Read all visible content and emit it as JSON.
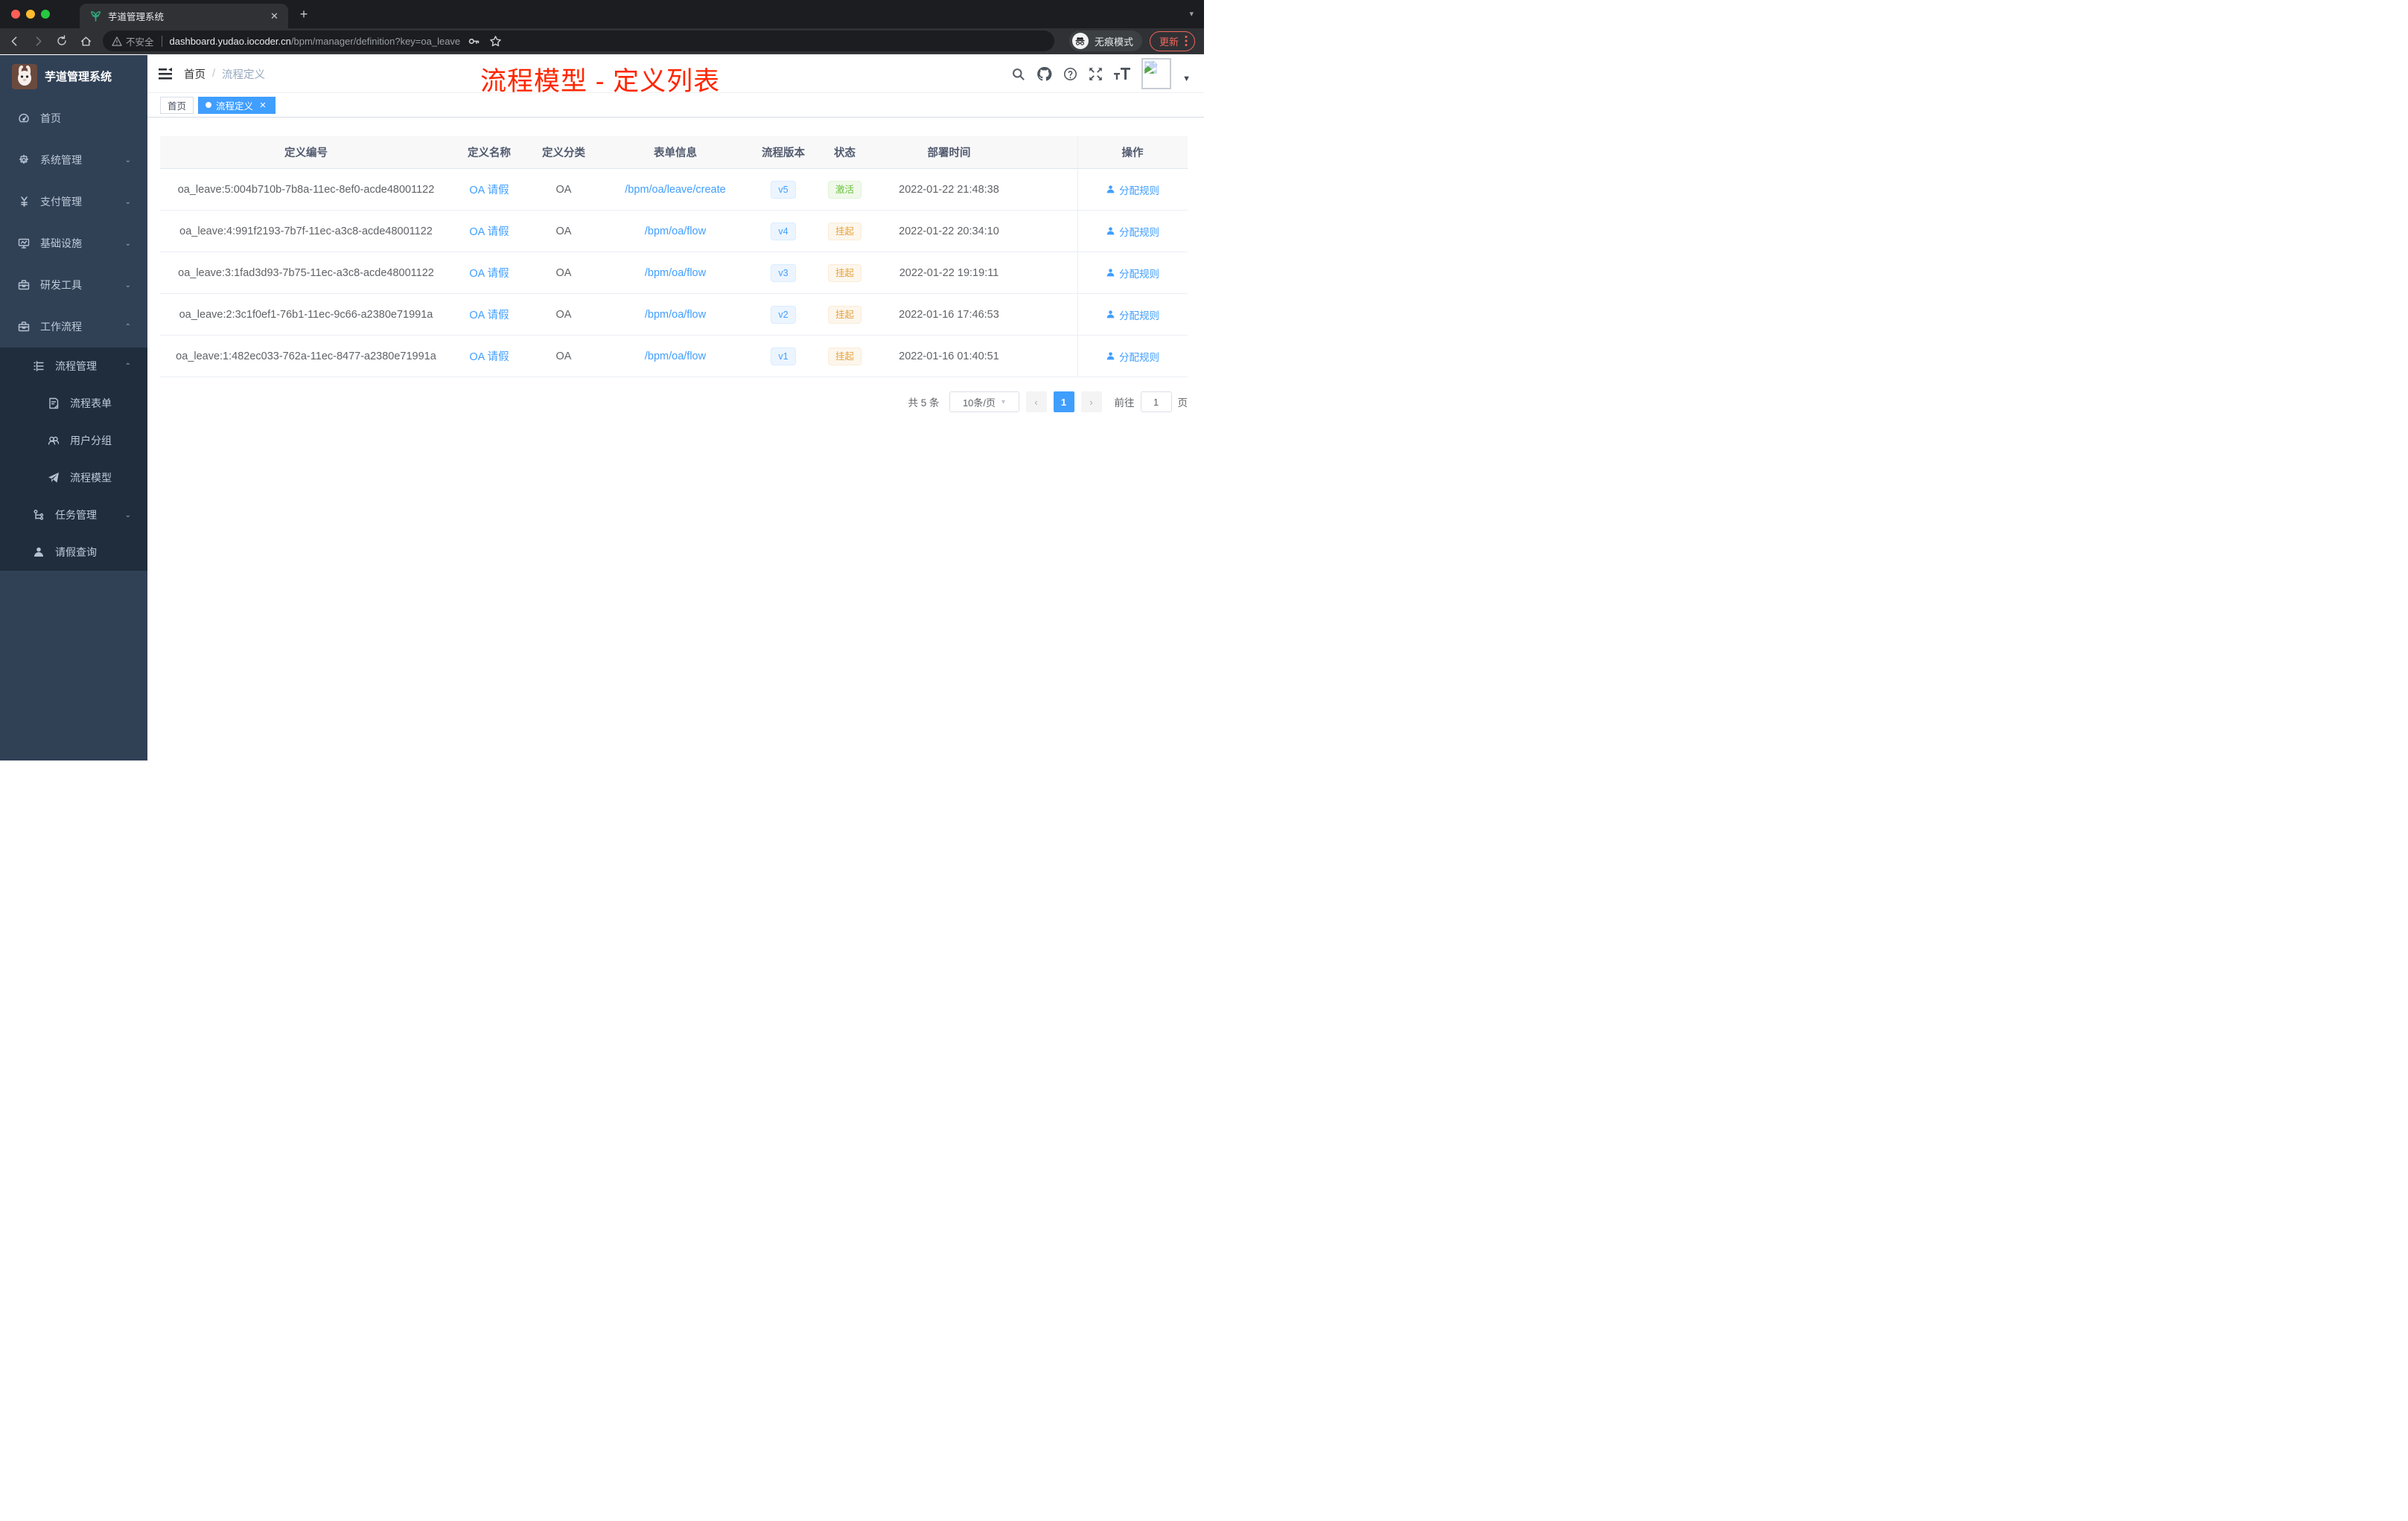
{
  "browser": {
    "tab_title": "芋道管理系统",
    "security_label": "不安全",
    "url_host": "dashboard.yudao.iocoder.cn",
    "url_path": "/bpm/manager/definition?key=oa_leave",
    "incognito_label": "无痕模式",
    "update_label": "更新"
  },
  "sidebar": {
    "app_name": "芋道管理系统",
    "items": [
      {
        "label": "首页",
        "icon": "dashboard-icon",
        "level": 1,
        "chevron": "",
        "submenu": false
      },
      {
        "label": "系统管理",
        "icon": "gear-icon",
        "level": 1,
        "chevron": "down",
        "submenu": false
      },
      {
        "label": "支付管理",
        "icon": "yen-icon",
        "level": 1,
        "chevron": "down",
        "submenu": false
      },
      {
        "label": "基础设施",
        "icon": "monitor-icon",
        "level": 1,
        "chevron": "down",
        "submenu": false
      },
      {
        "label": "研发工具",
        "icon": "toolbox-icon",
        "level": 1,
        "chevron": "down",
        "submenu": false
      },
      {
        "label": "工作流程",
        "icon": "briefcase-icon",
        "level": 1,
        "chevron": "up",
        "submenu": false
      },
      {
        "label": "流程管理",
        "icon": "tree-list-icon",
        "level": 2,
        "chevron": "up",
        "submenu": true
      },
      {
        "label": "流程表单",
        "icon": "form-icon",
        "level": 3,
        "chevron": "",
        "submenu": true
      },
      {
        "label": "用户分组",
        "icon": "users-icon",
        "level": 3,
        "chevron": "",
        "submenu": true
      },
      {
        "label": "流程模型",
        "icon": "paper-plane-icon",
        "level": 3,
        "chevron": "",
        "submenu": true
      },
      {
        "label": "任务管理",
        "icon": "org-icon",
        "level": 2,
        "chevron": "down",
        "submenu": true
      },
      {
        "label": "请假查询",
        "icon": "user-icon",
        "level": 2,
        "chevron": "",
        "submenu": true
      }
    ]
  },
  "header": {
    "breadcrumb": {
      "home": "首页",
      "separator": "/",
      "current": "流程定义"
    },
    "annotation": "流程模型 - 定义列表"
  },
  "tags": [
    {
      "label": "首页",
      "active": false,
      "closable": false
    },
    {
      "label": "流程定义",
      "active": true,
      "closable": true
    }
  ],
  "table": {
    "columns": [
      "定义编号",
      "定义名称",
      "定义分类",
      "表单信息",
      "流程版本",
      "状态",
      "部署时间",
      "操作"
    ],
    "rows": [
      {
        "id": "oa_leave:5:004b710b-7b8a-11ec-8ef0-acde48001122",
        "name": "OA 请假",
        "category": "OA",
        "form": "/bpm/oa/leave/create",
        "version": "v5",
        "status": "激活",
        "status_type": "success",
        "deploy_time": "2022-01-22 21:48:38",
        "action": "分配规则"
      },
      {
        "id": "oa_leave:4:991f2193-7b7f-11ec-a3c8-acde48001122",
        "name": "OA 请假",
        "category": "OA",
        "form": "/bpm/oa/flow",
        "version": "v4",
        "status": "挂起",
        "status_type": "warning",
        "deploy_time": "2022-01-22 20:34:10",
        "action": "分配规则"
      },
      {
        "id": "oa_leave:3:1fad3d93-7b75-11ec-a3c8-acde48001122",
        "name": "OA 请假",
        "category": "OA",
        "form": "/bpm/oa/flow",
        "version": "v3",
        "status": "挂起",
        "status_type": "warning",
        "deploy_time": "2022-01-22 19:19:11",
        "action": "分配规则"
      },
      {
        "id": "oa_leave:2:3c1f0ef1-76b1-11ec-9c66-a2380e71991a",
        "name": "OA 请假",
        "category": "OA",
        "form": "/bpm/oa/flow",
        "version": "v2",
        "status": "挂起",
        "status_type": "warning",
        "deploy_time": "2022-01-16 17:46:53",
        "action": "分配规则"
      },
      {
        "id": "oa_leave:1:482ec033-762a-11ec-8477-a2380e71991a",
        "name": "OA 请假",
        "category": "OA",
        "form": "/bpm/oa/flow",
        "version": "v1",
        "status": "挂起",
        "status_type": "warning",
        "deploy_time": "2022-01-16 01:40:51",
        "action": "分配规则"
      }
    ]
  },
  "pagination": {
    "total_label": "共 5 条",
    "page_size": "10条/页",
    "current_page": "1",
    "goto_label": "前往",
    "goto_value": "1",
    "page_suffix": "页"
  },
  "icons": {
    "tab_favicon": "plant-icon",
    "toolbar": [
      "back-icon",
      "forward-icon",
      "reload-icon",
      "home-icon",
      "warning-icon",
      "key-icon",
      "star-icon",
      "incognito-icon",
      "kebab-icon"
    ],
    "navbar_right": [
      "search-icon",
      "github-icon",
      "question-icon",
      "fullscreen-icon",
      "fontsize-icon",
      "broken-image-icon",
      "caret-down-icon"
    ],
    "row_action_icon": "user-icon"
  },
  "colors": {
    "accent": "#409eff",
    "success": "#67c23a",
    "warning": "#e6a23c",
    "annotation_red": "#ff2600",
    "update_salmon": "#ee675c",
    "sidebar_bg": "#304156",
    "submenu_bg": "#1f2d3d"
  }
}
